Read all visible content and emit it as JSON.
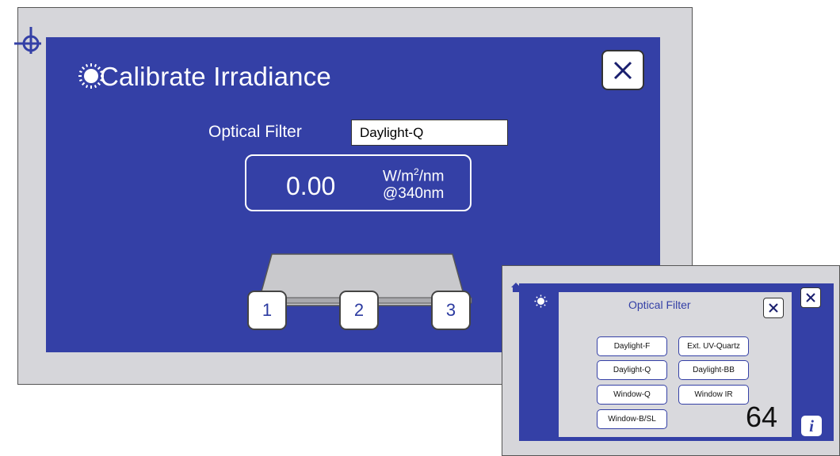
{
  "main": {
    "title": "Calibrate Irradiance",
    "optical_filter_label": "Optical Filter",
    "optical_filter_value": "Daylight-Q",
    "reading": {
      "value": "0.00",
      "unit_base": "W/m",
      "unit_exp": "2",
      "unit_rest": "/nm",
      "wavelength": "@340nm"
    },
    "positions": [
      "1",
      "2",
      "3"
    ],
    "close_symbol": "✕"
  },
  "inset": {
    "popup_title": "Optical Filter",
    "options": [
      "Daylight-F",
      "Ext. UV-Quartz",
      "Daylight-Q",
      "Daylight-BB",
      "Window-Q",
      "Window IR",
      "Window-B/SL"
    ],
    "page_number": "64",
    "info_symbol": "i",
    "close_symbol": "✕"
  },
  "colors": {
    "panel_blue": "#3440a6",
    "bezel_gray": "#d6d6da",
    "popup_gray": "#d9d9dd"
  },
  "icons": [
    "crosshair-icon",
    "sun-icon",
    "close-icon",
    "home-icon",
    "info-icon"
  ]
}
